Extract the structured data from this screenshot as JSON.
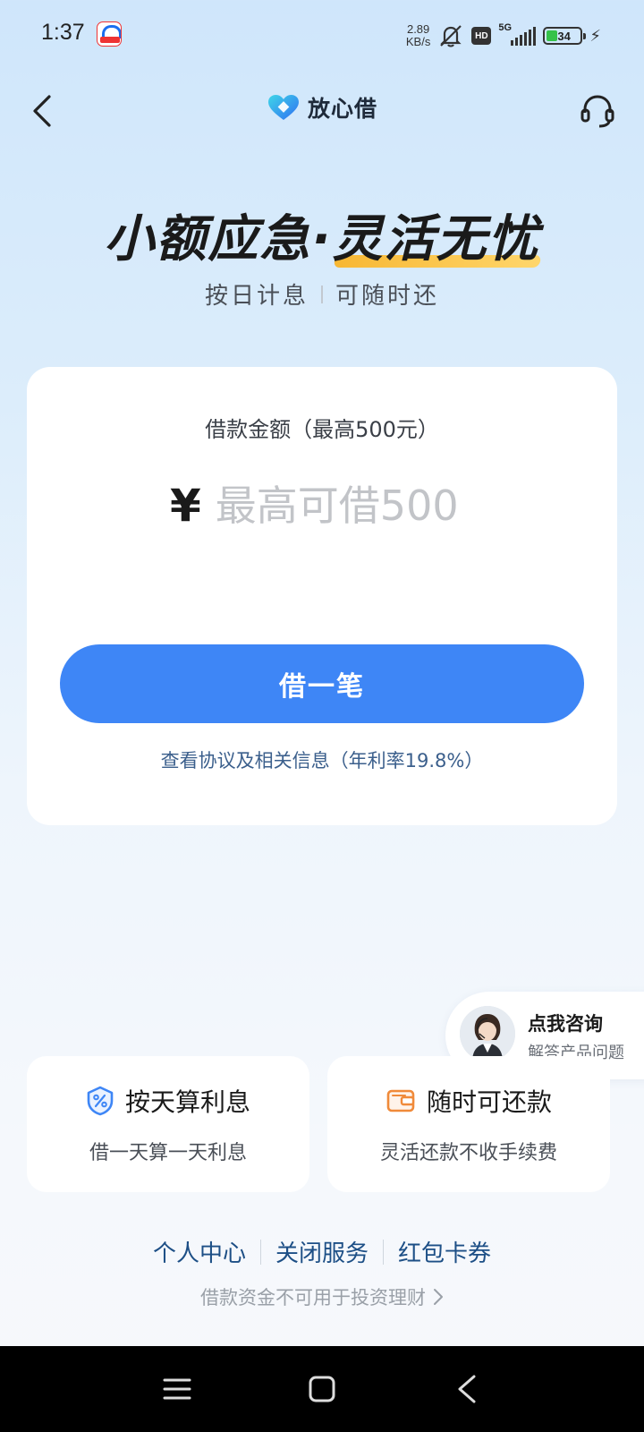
{
  "status_bar": {
    "time": "1:37",
    "net_speed_value": "2.89",
    "net_speed_unit": "KB/s",
    "hd": "HD",
    "network": "5G",
    "battery": "34"
  },
  "header": {
    "brand": "放心借"
  },
  "hero": {
    "title_a": "小额应急·",
    "title_b": "灵活无忧",
    "sub_left": "按日计息",
    "sub_right": "可随时还"
  },
  "loan_card": {
    "amount_label": "借款金额（最高500元）",
    "currency": "¥",
    "amount_placeholder": "最高可借500",
    "amount_value": "",
    "button_label": "借一笔",
    "agreement": "查看协议及相关信息（年利率19.8%）"
  },
  "consult": {
    "title": "点我咨询",
    "subtitle": "解答产品问题"
  },
  "features": [
    {
      "icon": "percent-shield-icon",
      "title": "按天算利息",
      "desc": "借一天算一天利息",
      "color": "#3e86f6"
    },
    {
      "icon": "wallet-icon",
      "title": "随时可还款",
      "desc": "灵活还款不收手续费",
      "color": "#f08a3a"
    }
  ],
  "footer": {
    "links": [
      "个人中心",
      "关闭服务",
      "红包卡券"
    ],
    "disclaimer": "借款资金不可用于投资理财"
  },
  "colors": {
    "primary": "#3e86f6",
    "link": "#1d4f86",
    "accent_underline": "#f7b733"
  }
}
